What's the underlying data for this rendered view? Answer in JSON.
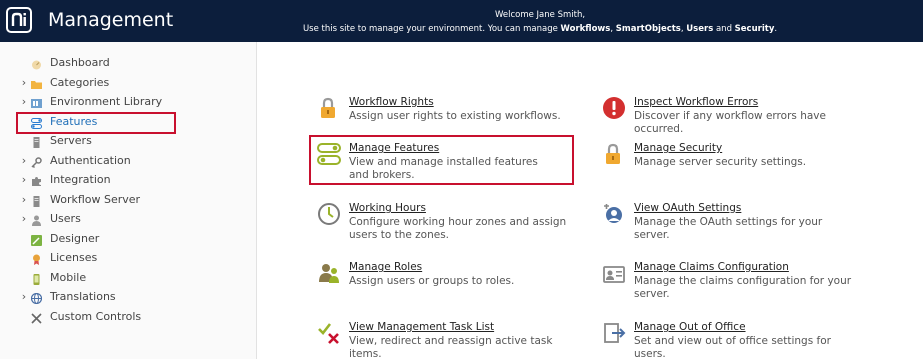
{
  "header": {
    "title": "Management",
    "welcome_line": "Welcome Jane Smith,",
    "intro": "Use this site to manage your environment. You can manage ",
    "workflows": "Workflows",
    "smartobjects": "SmartObjects",
    "users": "Users",
    "and": " and ",
    "security": "Security",
    "end": "."
  },
  "sidebar": {
    "items": [
      {
        "label": "Dashboard",
        "icon": "dashboard-icon",
        "expandable": false
      },
      {
        "label": "Categories",
        "icon": "folder-icon",
        "expandable": true
      },
      {
        "label": "Environment Library",
        "icon": "library-icon",
        "expandable": true
      },
      {
        "label": "Features",
        "icon": "features-icon",
        "expandable": false,
        "selected": true
      },
      {
        "label": "Servers",
        "icon": "server-icon",
        "expandable": false
      },
      {
        "label": "Authentication",
        "icon": "key-icon",
        "expandable": true
      },
      {
        "label": "Integration",
        "icon": "puzzle-icon",
        "expandable": true
      },
      {
        "label": "Workflow Server",
        "icon": "workflow-server-icon",
        "expandable": true
      },
      {
        "label": "Users",
        "icon": "user-icon",
        "expandable": true
      },
      {
        "label": "Designer",
        "icon": "designer-icon",
        "expandable": false
      },
      {
        "label": "Licenses",
        "icon": "license-icon",
        "expandable": false
      },
      {
        "label": "Mobile",
        "icon": "mobile-icon",
        "expandable": false
      },
      {
        "label": "Translations",
        "icon": "globe-icon",
        "expandable": true
      },
      {
        "label": "Custom Controls",
        "icon": "tools-icon",
        "expandable": false
      }
    ]
  },
  "cards": [
    {
      "title": "Workflow Rights",
      "desc": "Assign user rights to existing workflows.",
      "icon": "lock-icon"
    },
    {
      "title": "Inspect Workflow Errors",
      "desc": "Discover if any workflow errors have occurred.",
      "icon": "error-icon"
    },
    {
      "title": "Manage Features",
      "desc": "View and manage installed features and brokers.",
      "icon": "features-toggle-icon"
    },
    {
      "title": "Manage Security",
      "desc": "Manage server security settings.",
      "icon": "lock-icon"
    },
    {
      "title": "Working Hours",
      "desc": "Configure working hour zones and assign users to the zones.",
      "icon": "clock-icon"
    },
    {
      "title": "View OAuth Settings",
      "desc": "Manage the OAuth settings for your server.",
      "icon": "oauth-icon"
    },
    {
      "title": "Manage Roles",
      "desc": "Assign users or groups to roles.",
      "icon": "roles-icon"
    },
    {
      "title": "Manage Claims Configuration",
      "desc": "Manage the claims configuration for your server.",
      "icon": "claims-icon"
    },
    {
      "title": "View Management Task List",
      "desc": "View, redirect and reassign active task items.",
      "icon": "task-list-icon"
    },
    {
      "title": "Manage Out of Office",
      "desc": "Set and view out of office settings for users.",
      "icon": "out-of-office-icon"
    }
  ],
  "colors": {
    "header_bg": "#0c1e3c",
    "highlight": "#c8102e",
    "link_selected": "#1f6fb8"
  }
}
